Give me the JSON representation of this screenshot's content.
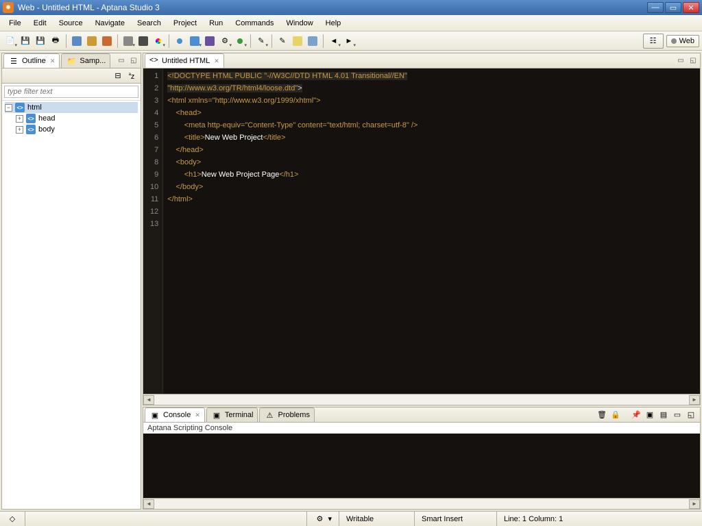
{
  "window": {
    "title": "Web - Untitled HTML - Aptana Studio 3"
  },
  "menu": [
    "File",
    "Edit",
    "Source",
    "Navigate",
    "Search",
    "Project",
    "Run",
    "Commands",
    "Window",
    "Help"
  ],
  "perspective": {
    "active": "Web"
  },
  "sidebar": {
    "tabs": [
      {
        "label": "Outline",
        "active": true
      },
      {
        "label": "Samp...",
        "active": false
      }
    ],
    "filter_placeholder": "type filter text",
    "tree": {
      "root": "html",
      "children": [
        "head",
        "body"
      ]
    }
  },
  "editor": {
    "tab_label": "Untitled HTML",
    "lines": [
      {
        "n": 1,
        "html": "<span class='c-doctype c-bg'>&lt;!DOCTYPE HTML PUBLIC </span><span class='c-str c-bg'>\"-//W3C//DTD HTML 4.01 Transitional//EN\"</span>"
      },
      {
        "n": 2,
        "html": "<span class='c-str c-bg'>\"http://www.w3.org/TR/html4/loose.dtd\"</span><span class='c-bg'>&gt;</span>"
      },
      {
        "n": 3,
        "html": "<span class='c-tag'>&lt;html </span><span class='c-attr'>xmlns=</span><span class='c-str'>\"http://www.w3.org/1999/xhtml\"</span><span class='c-tag'>&gt;</span>"
      },
      {
        "n": 4,
        "html": "    <span class='c-tag'>&lt;head&gt;</span>"
      },
      {
        "n": 5,
        "html": "        <span class='c-tag'>&lt;meta </span><span class='c-attr'>http-equiv=</span><span class='c-str'>\"Content-Type\"</span> <span class='c-attr'>content=</span><span class='c-str'>\"text/html; charset=utf-8\"</span><span class='c-tag'> /&gt;</span>"
      },
      {
        "n": 6,
        "html": "        <span class='c-tag'>&lt;title&gt;</span><span class='c-text'>New Web Project</span><span class='c-tag'>&lt;/title&gt;</span>"
      },
      {
        "n": 7,
        "html": "    <span class='c-tag'>&lt;/head&gt;</span>"
      },
      {
        "n": 8,
        "html": "    <span class='c-tag'>&lt;body&gt;</span>"
      },
      {
        "n": 9,
        "html": "        <span class='c-tag'>&lt;h1&gt;</span><span class='c-text'>New Web Project Page</span><span class='c-tag'>&lt;/h1&gt;</span>"
      },
      {
        "n": 10,
        "html": "    <span class='c-tag'>&lt;/body&gt;</span>"
      },
      {
        "n": 11,
        "html": "<span class='c-tag'>&lt;/html&gt;</span>"
      },
      {
        "n": 12,
        "html": ""
      },
      {
        "n": 13,
        "html": ""
      }
    ]
  },
  "bottom": {
    "tabs": [
      {
        "label": "Console",
        "active": true
      },
      {
        "label": "Terminal",
        "active": false
      },
      {
        "label": "Problems",
        "active": false
      }
    ],
    "console_title": "Aptana Scripting Console"
  },
  "status": {
    "edit_mode": "Writable",
    "insert_mode": "Smart Insert",
    "cursor": "Line: 1 Column: 1"
  }
}
